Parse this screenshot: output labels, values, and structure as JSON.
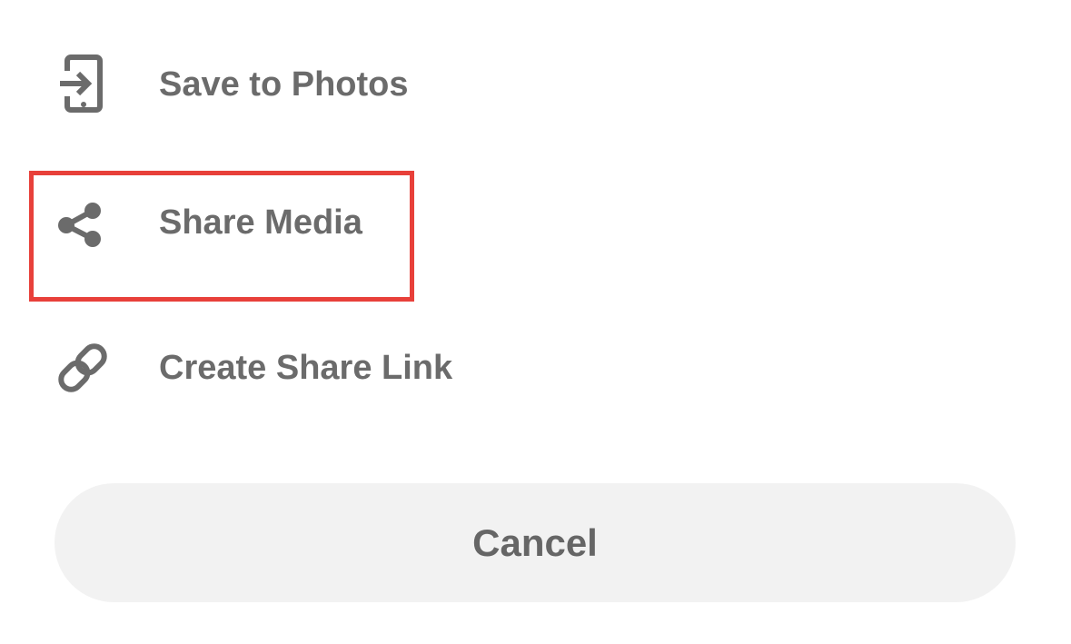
{
  "menu": {
    "items": [
      {
        "label": "Save to Photos",
        "icon": "save-to-device-icon"
      },
      {
        "label": "Share Media",
        "icon": "share-icon"
      },
      {
        "label": "Create Share Link",
        "icon": "link-icon"
      }
    ]
  },
  "cancel": {
    "label": "Cancel"
  },
  "colors": {
    "text": "#6b6b6b",
    "icon": "#6b6b6b",
    "highlight": "#e8403a",
    "cancel_bg": "#f2f2f2"
  }
}
